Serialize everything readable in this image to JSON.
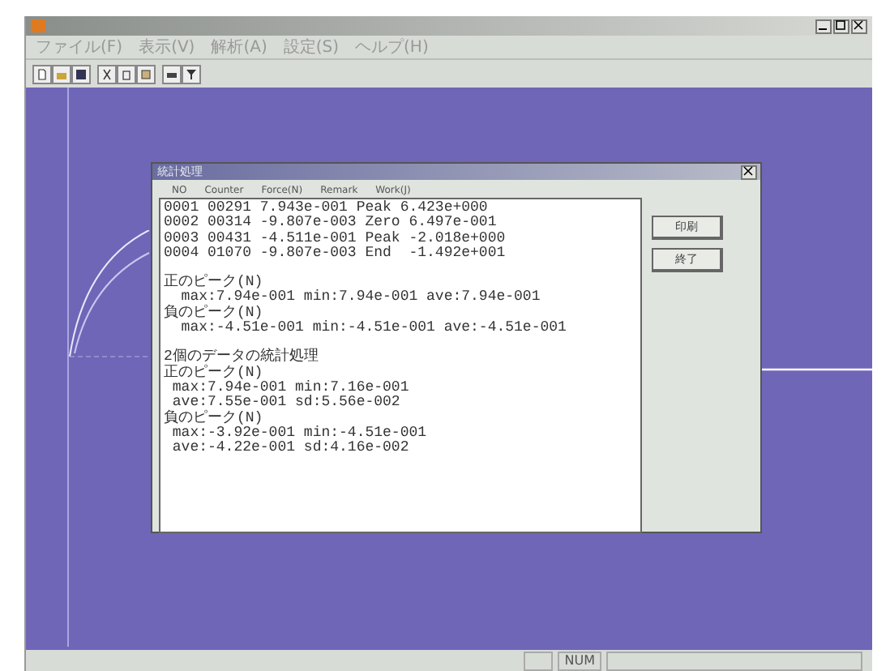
{
  "menu": [
    "ファイル(F)",
    "表示(V)",
    "解析(A)",
    "設定(S)",
    "ヘルプ(H)"
  ],
  "dialog": {
    "title": "統計処理",
    "columns": [
      "NO",
      "Counter",
      "Force(N)",
      "Remark",
      "Work(J)"
    ],
    "blocks": [
      {
        "lines": [
          "0001 00291 7.943e-001 Peak 6.423e+000",
          "0002 00314 -9.807e-003 Zero 6.497e-001",
          "0003 00431 -4.511e-001 Peak -2.018e+000",
          "0004 01070 -9.807e-003 End  -1.492e+001"
        ]
      },
      {
        "lines": [
          "正のピーク(N)",
          "  max:7.94e-001 min:7.94e-001 ave:7.94e-001",
          "負のピーク(N)",
          "  max:-4.51e-001 min:-4.51e-001 ave:-4.51e-001"
        ]
      },
      {
        "lines": [
          "2個のデータの統計処理",
          "正のピーク(N)",
          " max:7.94e-001 min:7.16e-001",
          " ave:7.55e-001 sd:5.56e-002",
          "負のピーク(N)",
          " max:-3.92e-001 min:-4.51e-001",
          " ave:-4.22e-001 sd:4.16e-002"
        ]
      }
    ],
    "buttons": [
      "印刷",
      "終了"
    ]
  },
  "status_bar": {
    "panels": [
      "NUM"
    ]
  }
}
